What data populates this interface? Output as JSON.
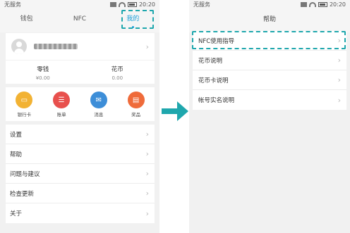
{
  "left": {
    "status": {
      "carrier": "无服务",
      "time": "20:20"
    },
    "tabs": [
      {
        "label": "钱包"
      },
      {
        "label": "NFC"
      },
      {
        "label": "我的"
      }
    ],
    "wallet": [
      {
        "label": "零钱",
        "value": "¥0.00"
      },
      {
        "label": "花币",
        "value": "0.00"
      }
    ],
    "shortcuts": [
      {
        "label": "银行卡",
        "icon": "bank-card-icon",
        "color": "#f2b233"
      },
      {
        "label": "账单",
        "icon": "bill-icon",
        "color": "#e8504d"
      },
      {
        "label": "消息",
        "icon": "message-icon",
        "color": "#3d8ed8"
      },
      {
        "label": "奖品",
        "icon": "gift-icon",
        "color": "#ef6b3a"
      }
    ],
    "menu": [
      {
        "label": "设置"
      },
      {
        "label": "帮助"
      },
      {
        "label": "问题与建议"
      },
      {
        "label": "检查更新"
      },
      {
        "label": "关于"
      }
    ]
  },
  "right": {
    "status": {
      "carrier": "无服务",
      "time": "20:20"
    },
    "title": "帮助",
    "menu": [
      {
        "label": "NFC使用指导"
      },
      {
        "label": "花币说明"
      },
      {
        "label": "花币卡说明"
      },
      {
        "label": "帐号实名说明"
      }
    ]
  },
  "colors": {
    "accent": "#1a9fd9",
    "highlight": "#1fa7ad"
  }
}
